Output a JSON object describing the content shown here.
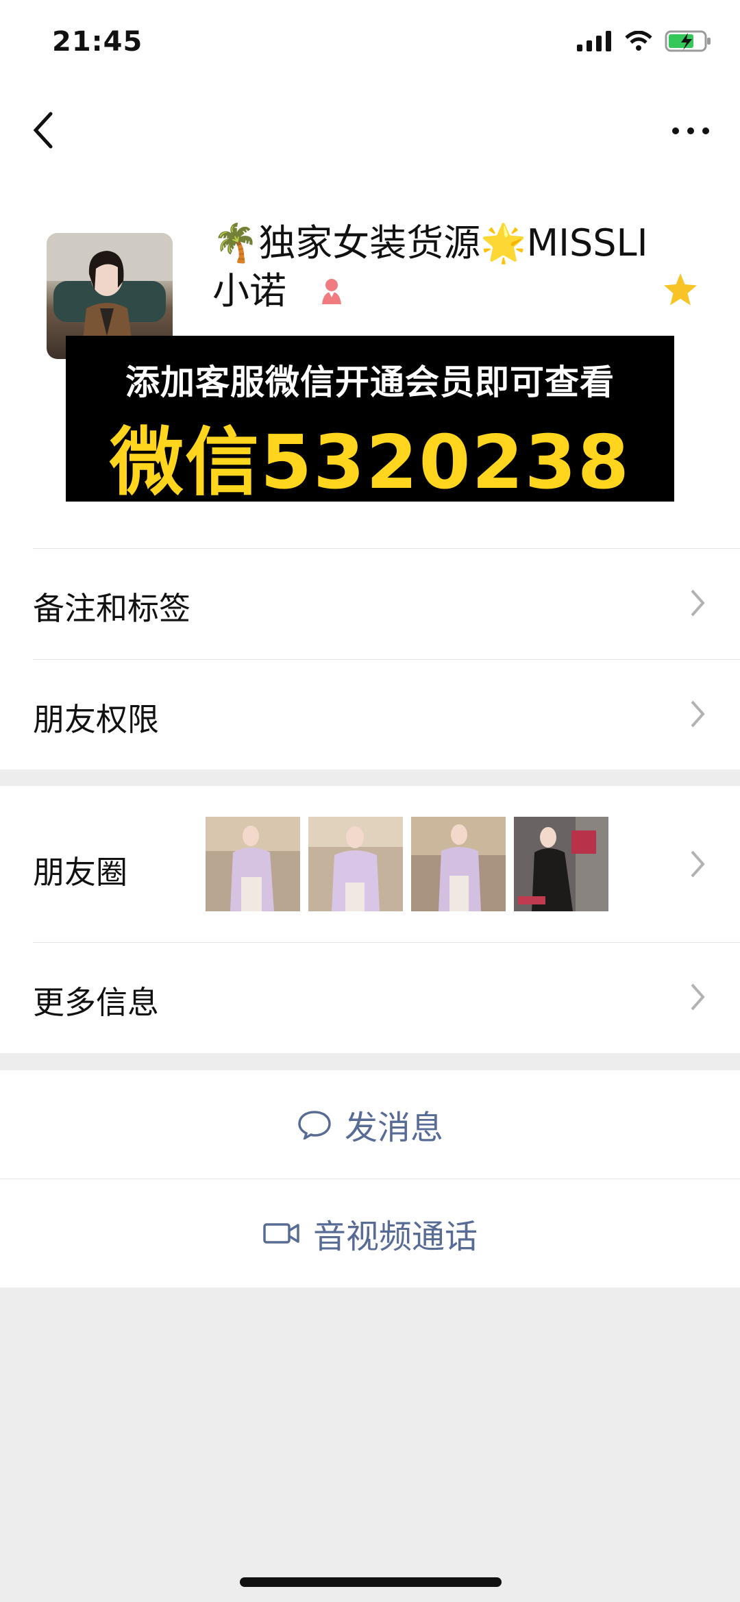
{
  "status_bar": {
    "time": "21:45",
    "battery_state": "charging"
  },
  "profile": {
    "name_line1": "🌴独家女装货源🌟MISSLI",
    "name_line2": "小诺"
  },
  "overlay": {
    "line1": "添加客服微信开通会员即可查看",
    "line2": "微信5320238"
  },
  "menu": {
    "remarks_label": "备注和标签",
    "permissions_label": "朋友权限",
    "moments_label": "朋友圈",
    "more_info_label": "更多信息"
  },
  "actions": {
    "message_label": "发消息",
    "call_label": "音视频通话"
  },
  "colors": {
    "link": "#576b95",
    "accent_yellow": "#ffd51e",
    "background": "#ededed"
  },
  "icons": [
    "back-icon",
    "more-icon",
    "signal-icon",
    "wifi-icon",
    "battery-icon",
    "female-icon",
    "star-icon",
    "chevron-right-icon",
    "chat-bubble-icon",
    "video-camera-icon"
  ]
}
